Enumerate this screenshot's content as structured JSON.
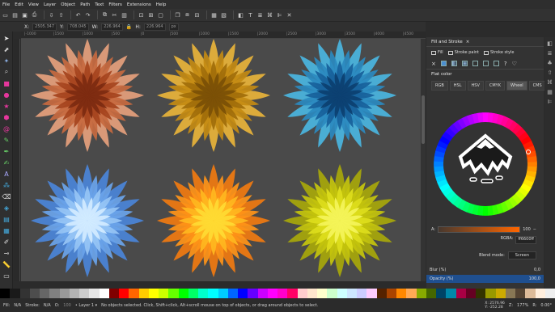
{
  "menu": [
    "File",
    "Edit",
    "View",
    "Layer",
    "Object",
    "Path",
    "Text",
    "Filters",
    "Extensions",
    "Help"
  ],
  "controls": {
    "x_label": "X:",
    "x": "2505.347",
    "y_label": "Y:",
    "y": "708.045",
    "w_label": "W:",
    "w": "226.964",
    "h_label": "H:",
    "h": "226.964",
    "unit": "px"
  },
  "ruler_ticks": [
    "|-1000",
    "|1500",
    "|1000",
    "|500",
    "|0",
    "|500",
    "|1000",
    "|1500",
    "|2000",
    "|2500",
    "|3000",
    "|3500",
    "|4000",
    "|4500"
  ],
  "panel": {
    "title": "Fill and Stroke",
    "close": "×",
    "tabs": [
      "Fill",
      "Stroke paint",
      "Stroke style"
    ],
    "flat_color": "Flat color",
    "color_tabs": [
      "RGB",
      "HSL",
      "HSV",
      "CMYK",
      "Wheel",
      "CMS"
    ],
    "active_tab": "Wheel",
    "alpha_label": "A:",
    "alpha_value": "100",
    "rgba_label": "RGBA:",
    "rgba_value": "ff6600ff",
    "blend_label": "Blend mode:",
    "blend_value": "Screen",
    "blur_label": "Blur (%)",
    "blur_value": "0,0",
    "opacity_label": "Opacity (%)",
    "opacity_value": "100,0"
  },
  "status": {
    "fill_label": "Fill:",
    "fill": "N/A",
    "stroke_label": "Stroke:",
    "stroke": "N/A",
    "opacity": "100",
    "layer": "• Layer 1 ▾",
    "message": "No objects selected. Click, Shift+click, Alt+scroll mouse on top of objects, or drag around objects to select.",
    "x": "X: 2576.96",
    "y": "Y: -252.28",
    "z_label": "Z:",
    "zoom": "177%",
    "r_label": "R:",
    "rotation": "0.00°"
  },
  "colors": {
    "flowers": [
      [
        "#e5a07c",
        "#c7693f",
        "#a5431d",
        "#7c2a10"
      ],
      [
        "#e8b33a",
        "#c38a12",
        "#a06c0a",
        "#7a4f06"
      ],
      [
        "#4ab5e0",
        "#2a89bf",
        "#17609a",
        "#0c3f70"
      ],
      [
        "#4a84d8",
        "#6aa4ea",
        "#97c6f5",
        "#d3ecff"
      ],
      [
        "#f07a10",
        "#ff9418",
        "#ffb91f",
        "#ffdb33"
      ],
      [
        "#a7a70a",
        "#c4c40c",
        "#dede1c",
        "#f4f45a"
      ]
    ],
    "accent": "#ff6600"
  },
  "palette": [
    "#000000",
    "#1a1a1a",
    "#333333",
    "#4d4d4d",
    "#666666",
    "#808080",
    "#999999",
    "#b3b3b3",
    "#cccccc",
    "#e6e6e6",
    "#ffffff",
    "#800000",
    "#ff0000",
    "#ff6600",
    "#ffcc00",
    "#ffff00",
    "#ccff00",
    "#66ff00",
    "#00ff00",
    "#00ff66",
    "#00ffcc",
    "#00ffff",
    "#00ccff",
    "#0066ff",
    "#0000ff",
    "#6600ff",
    "#cc00ff",
    "#ff00ff",
    "#ff00cc",
    "#ff0066",
    "#ffcccc",
    "#ffe6cc",
    "#ffffcc",
    "#ccffcc",
    "#ccffff",
    "#cce6ff",
    "#ccccff",
    "#ffccff",
    "#552200",
    "#aa4400",
    "#ff8800",
    "#ffaa55",
    "#88aa00",
    "#446600",
    "#004466",
    "#0088aa",
    "#aa0044",
    "#660022",
    "#333300",
    "#999900",
    "#ccaa00",
    "#887755",
    "#554433",
    "#ddbb99",
    "#ffeedd",
    "#eeeeee"
  ]
}
